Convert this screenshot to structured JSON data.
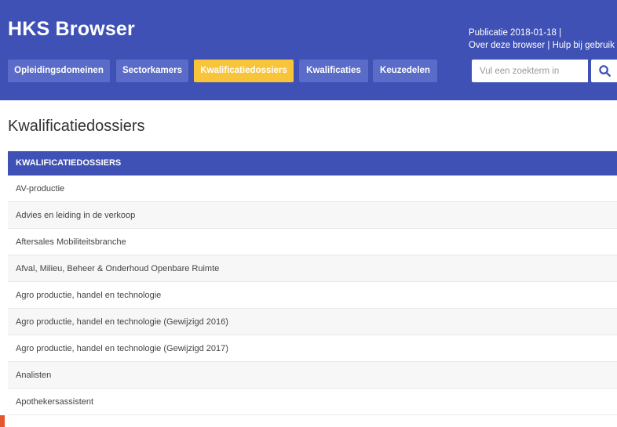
{
  "header": {
    "brand": "HKS Browser",
    "publication": "Publicatie 2018-01-18  |",
    "link_about": "Over deze browser",
    "link_sep": "|",
    "link_help": "Hulp bij gebruik"
  },
  "nav": {
    "items": [
      {
        "label": "Opleidingsdomeinen"
      },
      {
        "label": "Sectorkamers"
      },
      {
        "label": "Kwalificatiedossiers"
      },
      {
        "label": "Kwalificaties"
      },
      {
        "label": "Keuzedelen"
      }
    ],
    "active_index": 2
  },
  "search": {
    "placeholder": "Vul een zoekterm in",
    "icon": "search-icon"
  },
  "page": {
    "title": "Kwalificatiedossiers"
  },
  "table": {
    "header": "KWALIFICATIEDOSSIERS",
    "rows": [
      "AV-productie",
      "Advies en leiding in de verkoop",
      "Aftersales Mobiliteitsbranche",
      "Afval, Milieu, Beheer & Onderhoud Openbare Ruimte",
      "Agro productie, handel en technologie",
      "Agro productie, handel en technologie (Gewijzigd 2016)",
      "Agro productie, handel en technologie (Gewijzigd 2017)",
      "Analisten",
      "Apothekersassistent"
    ]
  },
  "colors": {
    "primary": "#3f51b5",
    "nav_button": "#5a6cc8",
    "active": "#f7c43a"
  }
}
